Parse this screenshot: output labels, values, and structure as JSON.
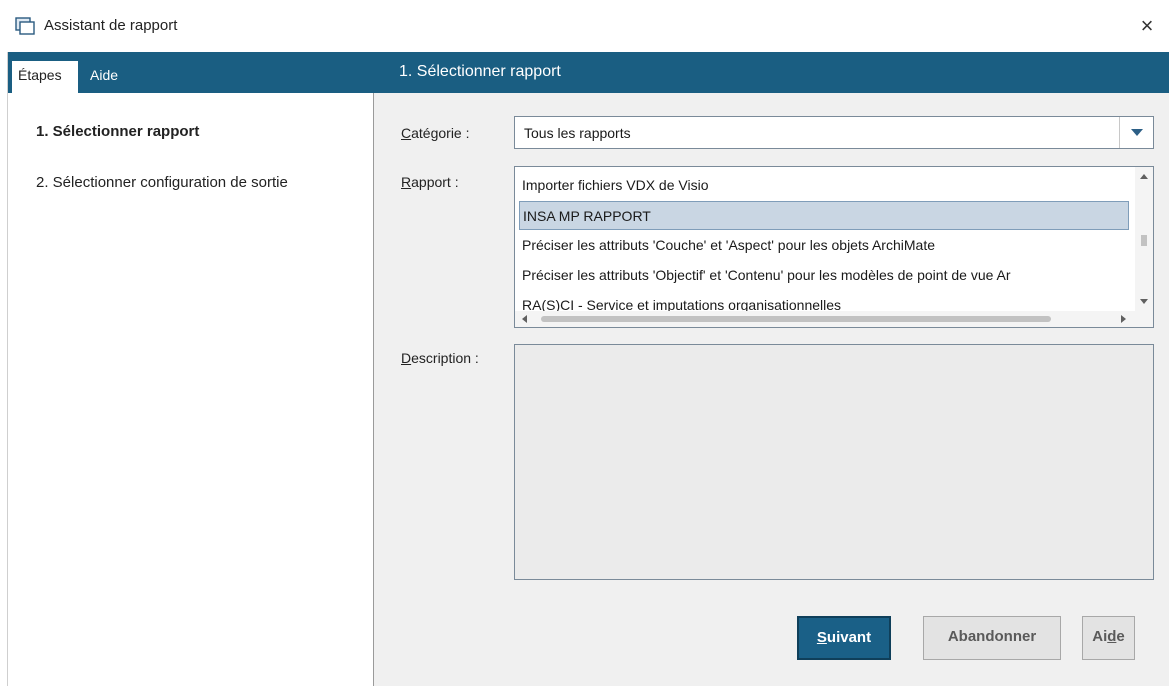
{
  "window": {
    "title": "Assistant de rapport",
    "close_label": "×",
    "icon": "window-icon"
  },
  "tabs": [
    {
      "label": "Étapes",
      "active": true
    },
    {
      "label": "Aide",
      "active": false
    }
  ],
  "header": {
    "title": "1. Sélectionner rapport"
  },
  "steps": [
    {
      "label": "1. Sélectionner rapport",
      "active": true
    },
    {
      "label": "2. Sélectionner configuration de sortie",
      "active": false
    }
  ],
  "form": {
    "category": {
      "label_first": "C",
      "label_rest": "atégorie :",
      "value": "Tous les rapports"
    },
    "report": {
      "label_first": "R",
      "label_rest": "apport :",
      "items": [
        "Importer fichiers VDX de Visio",
        "INSA MP RAPPORT",
        "Préciser les attributs 'Couche' et 'Aspect' pour les objets ArchiMate",
        "Préciser les attributs 'Objectif' et 'Contenu' pour les modèles de point de vue Ar",
        "RA(S)CI - Service et imputations organisationnelles"
      ],
      "selected_index": 1
    },
    "description": {
      "label_first": "D",
      "label_rest": "escription :",
      "value": ""
    }
  },
  "buttons": {
    "next_first": "S",
    "next_rest": "uivant",
    "cancel": "Abandonner",
    "help_pre": "Ai",
    "help_u": "d",
    "help_post": "e"
  },
  "colors": {
    "accent": "#1a5e82",
    "selection": "#c9d6e3"
  }
}
